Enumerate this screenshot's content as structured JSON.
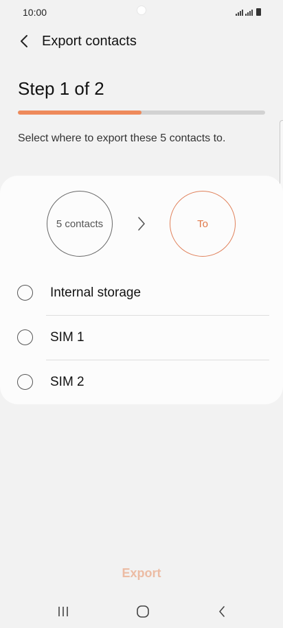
{
  "status_bar": {
    "time": "10:00"
  },
  "header": {
    "title": "Export contacts",
    "back_icon": "chevron-left-icon"
  },
  "wizard": {
    "step_title": "Step 1 of 2",
    "progress_fraction": 0.5,
    "accent_color": "#ee8a5b",
    "instruction": "Select where to export these 5 contacts to."
  },
  "flow": {
    "source_label": "5 contacts",
    "destination_label": "To",
    "arrow_icon": "chevron-right-icon"
  },
  "options": [
    {
      "label": "Internal storage",
      "selected": false
    },
    {
      "label": "SIM 1",
      "selected": false
    },
    {
      "label": "SIM 2",
      "selected": false
    }
  ],
  "footer": {
    "export_label": "Export",
    "export_color": "#ecbca4"
  },
  "nav_bar": {
    "recents_icon": "recents-icon",
    "home_icon": "home-icon",
    "back_icon": "back-icon"
  }
}
